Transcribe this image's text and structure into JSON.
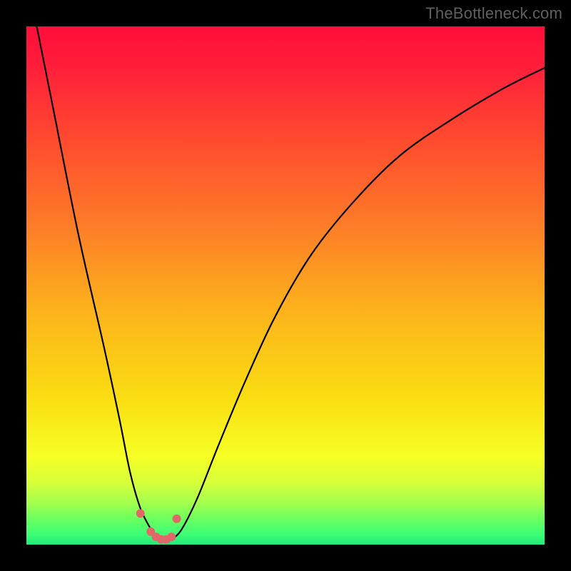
{
  "watermark": "TheBottleneck.com",
  "colors": {
    "frame": "#000000",
    "gradient_top": "#ff0d39",
    "gradient_mid1": "#fd7b28",
    "gradient_mid2": "#fade12",
    "gradient_bottom": "#23e87b",
    "curve": "#000000",
    "marker": "#e06868"
  },
  "chart_data": {
    "type": "line",
    "title": "",
    "xlabel": "",
    "ylabel": "",
    "xlim": [
      0,
      100
    ],
    "ylim": [
      0,
      100
    ],
    "series": [
      {
        "name": "bottleneck-curve",
        "x": [
          2,
          5,
          10,
          15,
          18,
          20,
          22,
          24,
          25,
          26,
          27,
          28,
          30,
          33,
          37,
          42,
          48,
          55,
          63,
          72,
          82,
          92,
          100
        ],
        "y": [
          100,
          85,
          60,
          38,
          24,
          14,
          7,
          3,
          1.5,
          1,
          0.8,
          1,
          3,
          9,
          19,
          31,
          44,
          56,
          66,
          75,
          82,
          88,
          92
        ]
      }
    ],
    "markers": {
      "name": "highlight-points",
      "x": [
        22,
        24,
        25,
        26,
        27,
        28,
        29
      ],
      "y": [
        6,
        2.5,
        1.5,
        1,
        1,
        1.5,
        5
      ]
    }
  }
}
